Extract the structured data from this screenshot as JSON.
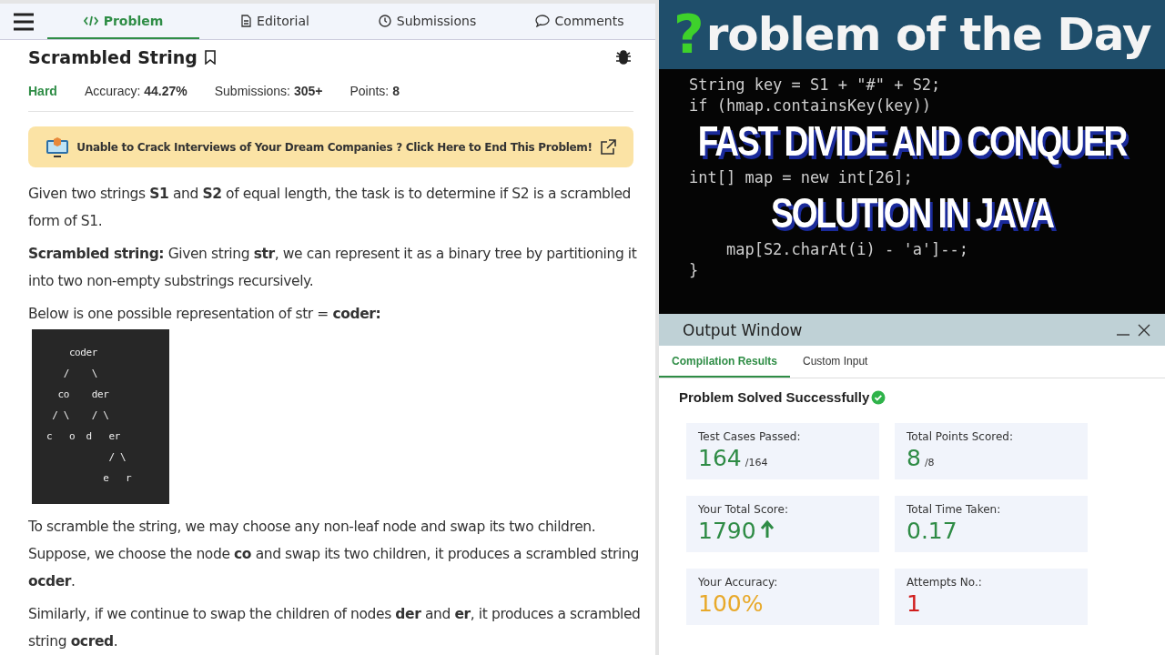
{
  "problem_page": {
    "tabs": [
      {
        "label": "Problem",
        "selected": true
      },
      {
        "label": "Editorial",
        "selected": false
      },
      {
        "label": "Submissions",
        "selected": false
      },
      {
        "label": "Comments",
        "selected": false
      }
    ],
    "title": "Scrambled String",
    "stats": [
      {
        "kind": "difficulty",
        "text": "Hard"
      },
      {
        "kind": "stat",
        "label": "Accuracy:",
        "value": "44.27%"
      },
      {
        "kind": "stat",
        "label": "Submissions:",
        "value": "305+"
      },
      {
        "kind": "stat",
        "label": "Points:",
        "value": "8"
      }
    ],
    "promo": "Unable to Crack Interviews of Your Dream Companies ? Click Here to End This Problem!",
    "blocks": [
      {
        "kind": "para",
        "text": "Given two strings **S1** and **S2** of equal length, the task is to determine if S2 is a scrambled form of S1."
      },
      {
        "kind": "para",
        "text": "**Scrambled string:** Given string **str**, we can represent it as a binary tree by partitioning it into two non-empty substrings recursively."
      },
      {
        "kind": "line",
        "text": "Below is one possible representation of str = **coder:**"
      },
      {
        "kind": "tree",
        "lines": [
          "    coder",
          "   /    \\",
          "  co    der",
          " / \\    / \\",
          "c   o  d   er",
          "           / \\",
          "          e   r"
        ]
      },
      {
        "kind": "line",
        "text": "To scramble the string, we may choose any non-leaf node and swap its two children."
      },
      {
        "kind": "para",
        "text": "Suppose, we choose the node **co** and swap its two children, it produces a scrambled string **ocder**."
      },
      {
        "kind": "line",
        "text": "Similarly, if we continue to swap the children of nodes **der** and **er**, it produces a scrambled string **ocred**."
      }
    ]
  },
  "banner": {
    "mark": "?",
    "title": "roblem of the Day"
  },
  "code_panel": [
    {
      "kind": "code",
      "lines": [
        "String key = S1 + \"#\" + S2;",
        "if (hmap.containsKey(key))"
      ]
    },
    {
      "kind": "headline",
      "text": "FAST DIVIDE AND CONQUER"
    },
    {
      "kind": "code",
      "lines": [
        "int[] map = new int[26];"
      ]
    },
    {
      "kind": "headline",
      "text": "SOLUTION IN JAVA"
    },
    {
      "kind": "code",
      "lines": [
        "    map[S2.charAt(i) - 'a']--;",
        "}"
      ]
    }
  ],
  "output_window": {
    "title": "Output Window",
    "tabs": [
      {
        "label": "Compilation Results",
        "selected": true
      },
      {
        "label": "Custom Input",
        "selected": false
      }
    ],
    "status": "Problem Solved Successfully",
    "cards": [
      {
        "kind": "plain",
        "label": "Test Cases Passed:",
        "value": "164",
        "suffix": "/164",
        "color": "#2e8b45"
      },
      {
        "kind": "plain",
        "label": "Total Points Scored:",
        "value": "8",
        "suffix": "/8",
        "color": "#2e8b45"
      },
      {
        "kind": "rising",
        "label": "Your Total Score:",
        "value": "1790",
        "color": "#2e8b45"
      },
      {
        "kind": "plain",
        "label": "Total Time Taken:",
        "value": "0.17",
        "color": "#2e8b45"
      },
      {
        "kind": "plain",
        "label": "Your Accuracy:",
        "value": "100%",
        "color": "#e8a92a"
      },
      {
        "kind": "plain",
        "label": "Attempts No.:",
        "value": "1",
        "color": "#d01c1c"
      }
    ]
  }
}
